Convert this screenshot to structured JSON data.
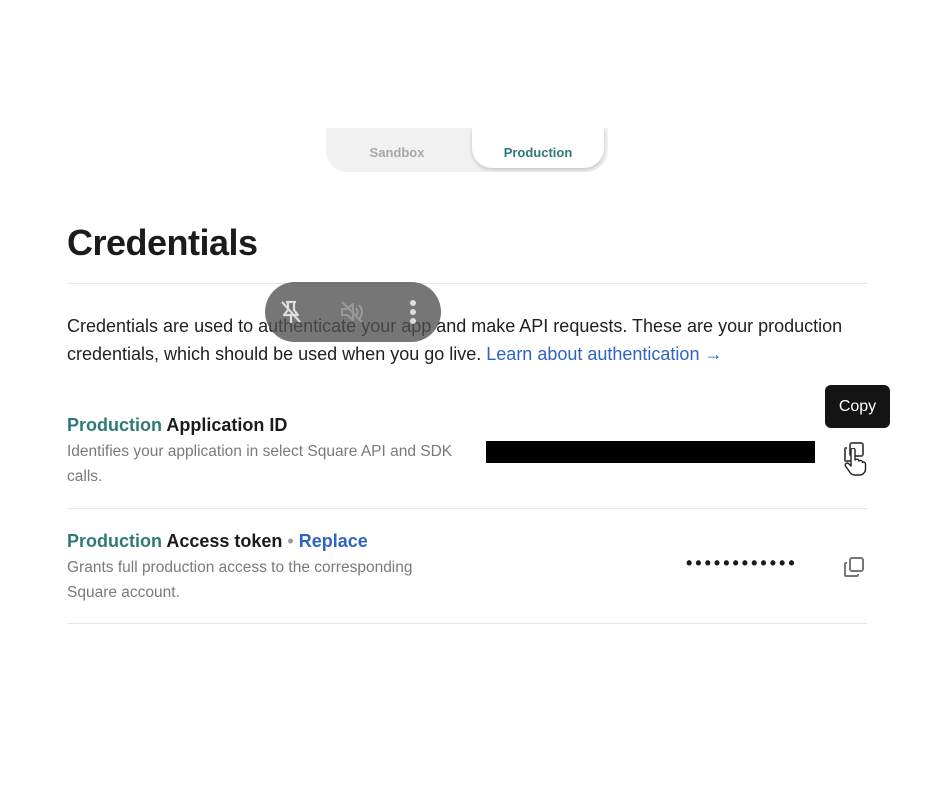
{
  "env_toggle": {
    "sandbox_label": "Sandbox",
    "production_label": "Production",
    "selected": "Production"
  },
  "page": {
    "title": "Credentials",
    "intro_text": "Credentials are used to authenticate your app and make API requests. These are your production credentials, which should be used when you go live.",
    "learn_link": "Learn about authentication →"
  },
  "credentials": {
    "app_id": {
      "env_label": "Production",
      "title": "Application ID",
      "description": "Identifies your application in select Square API and SDK calls."
    },
    "access_token": {
      "env_label": "Production",
      "title": "Access token",
      "separator": "•",
      "replace_label": "Replace",
      "description": "Grants full production access to the corresponding Square account.",
      "masked_value": "••••••••••••"
    }
  },
  "tooltip": {
    "copy_label": "Copy"
  },
  "overlay": {
    "icons": [
      "pin-off-icon",
      "volume-off-icon",
      "more-vertical-icon"
    ]
  },
  "colors": {
    "env_accent": "#2f7a75",
    "link": "#2f63c4",
    "muted_text": "#7a7a7a",
    "tooltip_bg": "#141414"
  }
}
